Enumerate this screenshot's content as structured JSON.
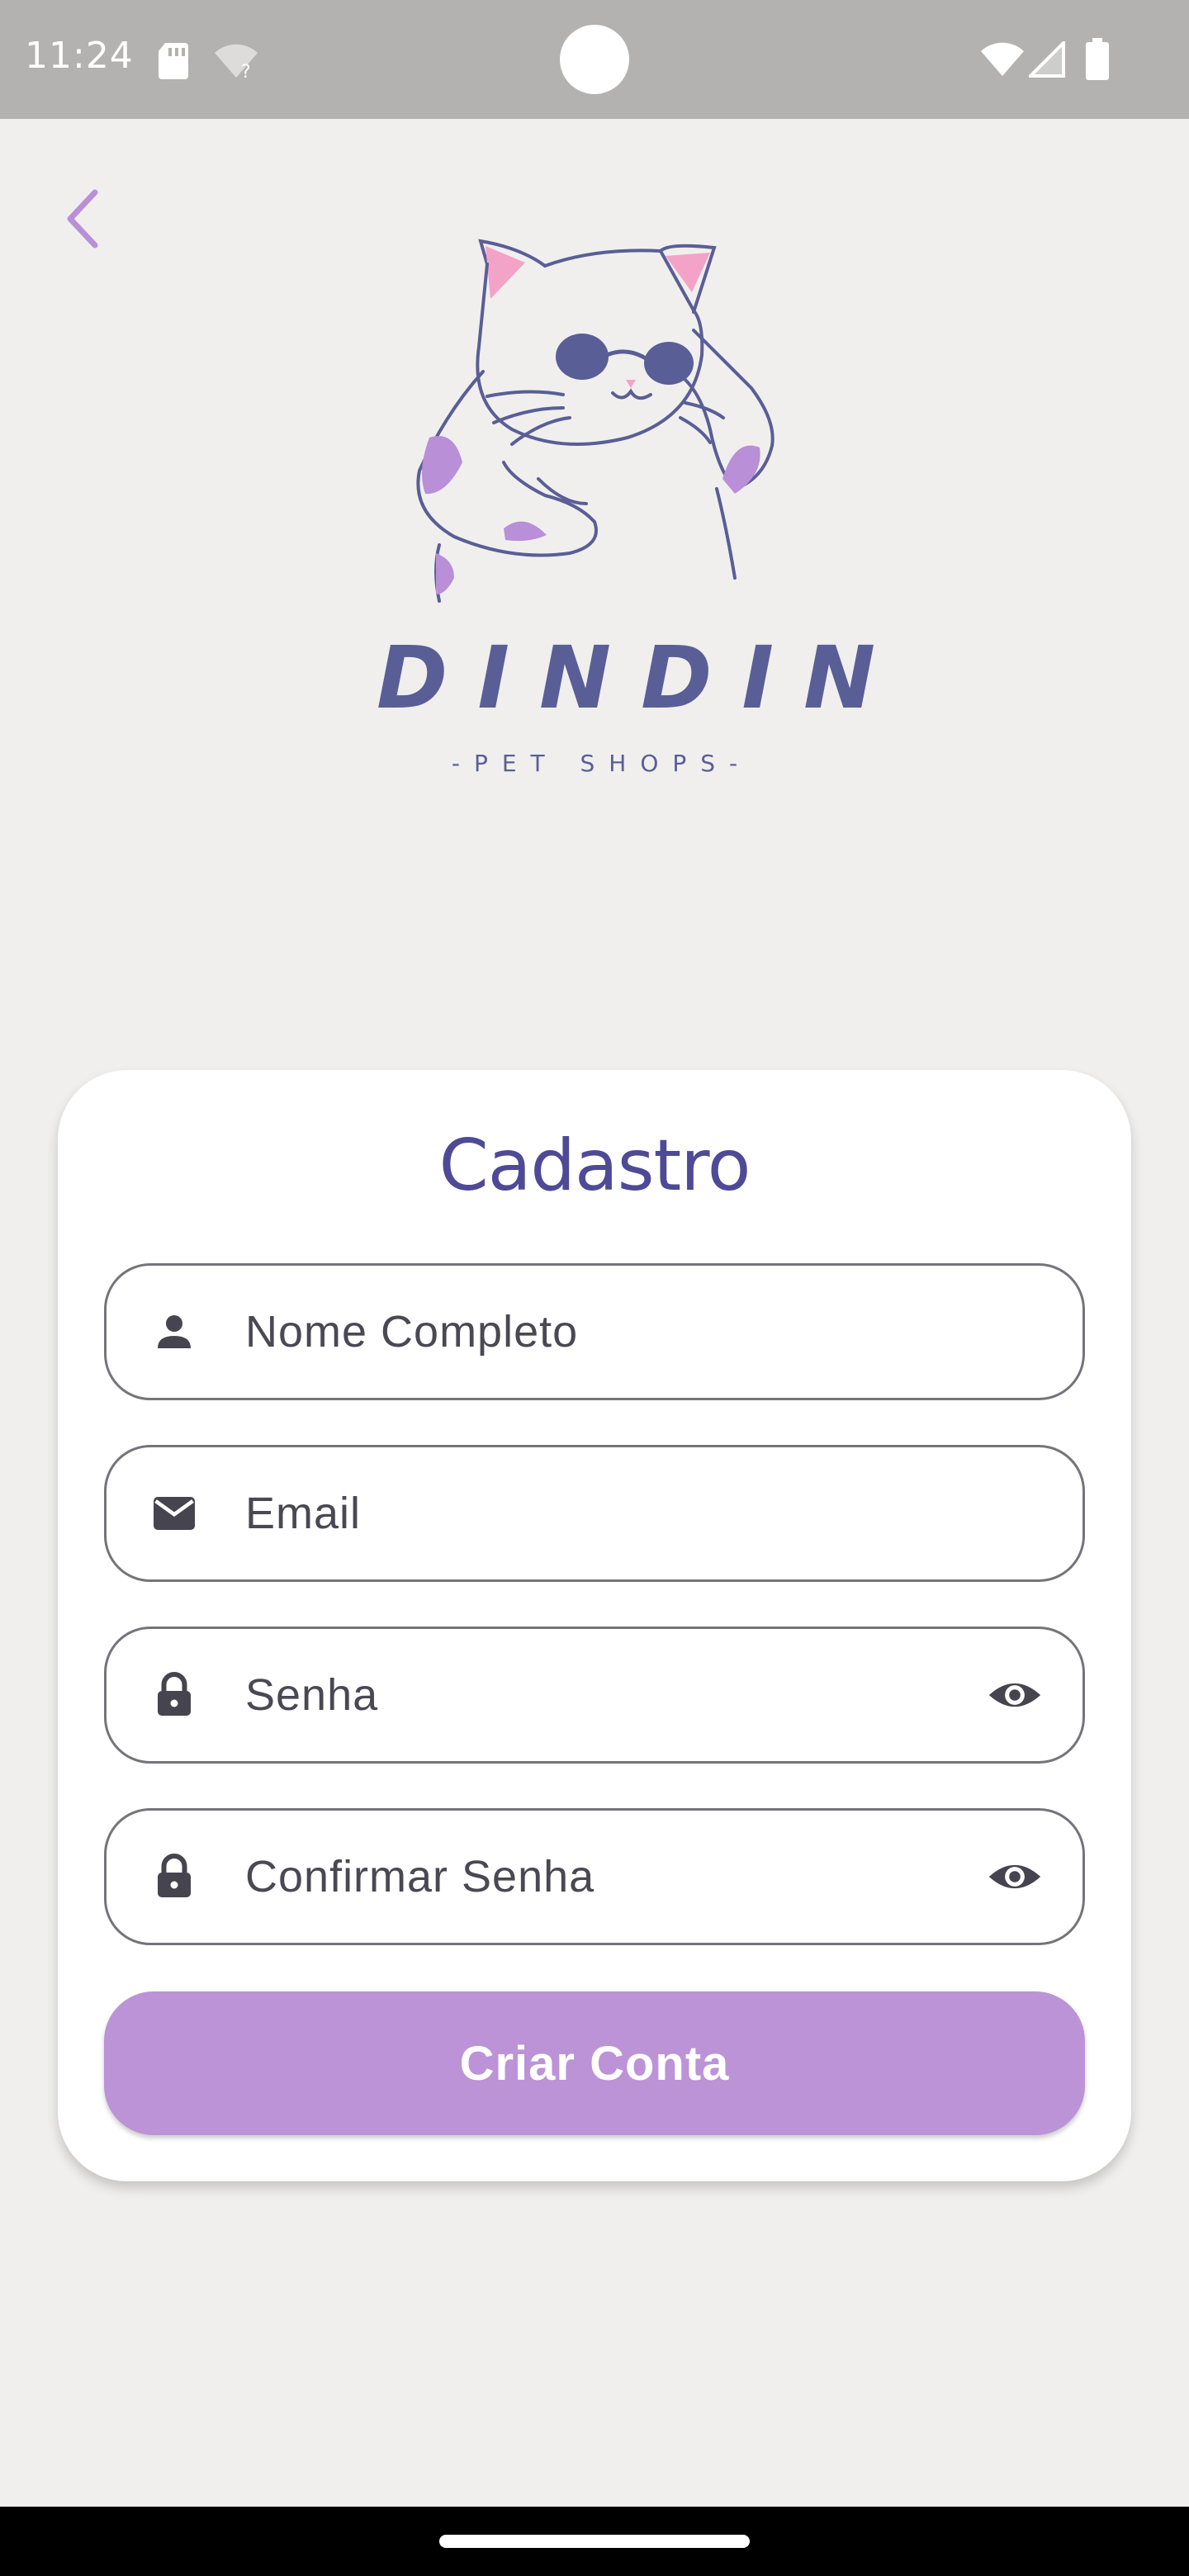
{
  "status_bar": {
    "time": "11:24",
    "icons": [
      "sd-card-icon",
      "wifi-unknown-icon",
      "wifi-icon",
      "signal-icon",
      "battery-icon"
    ]
  },
  "header": {
    "back_icon": "chevron-left-icon"
  },
  "logo": {
    "brand": "DINDIN",
    "tagline": "-PET SHOPS-"
  },
  "form": {
    "title": "Cadastro",
    "fields": [
      {
        "placeholder": "Nome Completo",
        "icon": "person-icon"
      },
      {
        "placeholder": "Email",
        "icon": "mail-icon"
      },
      {
        "placeholder": "Senha",
        "icon": "lock-icon",
        "trailing_icon": "eye-icon"
      },
      {
        "placeholder": "Confirmar Senha",
        "icon": "lock-icon",
        "trailing_icon": "eye-icon"
      }
    ],
    "submit_label": "Criar Conta"
  },
  "colors": {
    "accent": "#bb93d6",
    "title": "#4e4a96",
    "background": "#f0efee",
    "logo_ink": "#5a5e96",
    "logo_spots": "#b98fd8",
    "logo_ears": "#f4a3c8"
  }
}
